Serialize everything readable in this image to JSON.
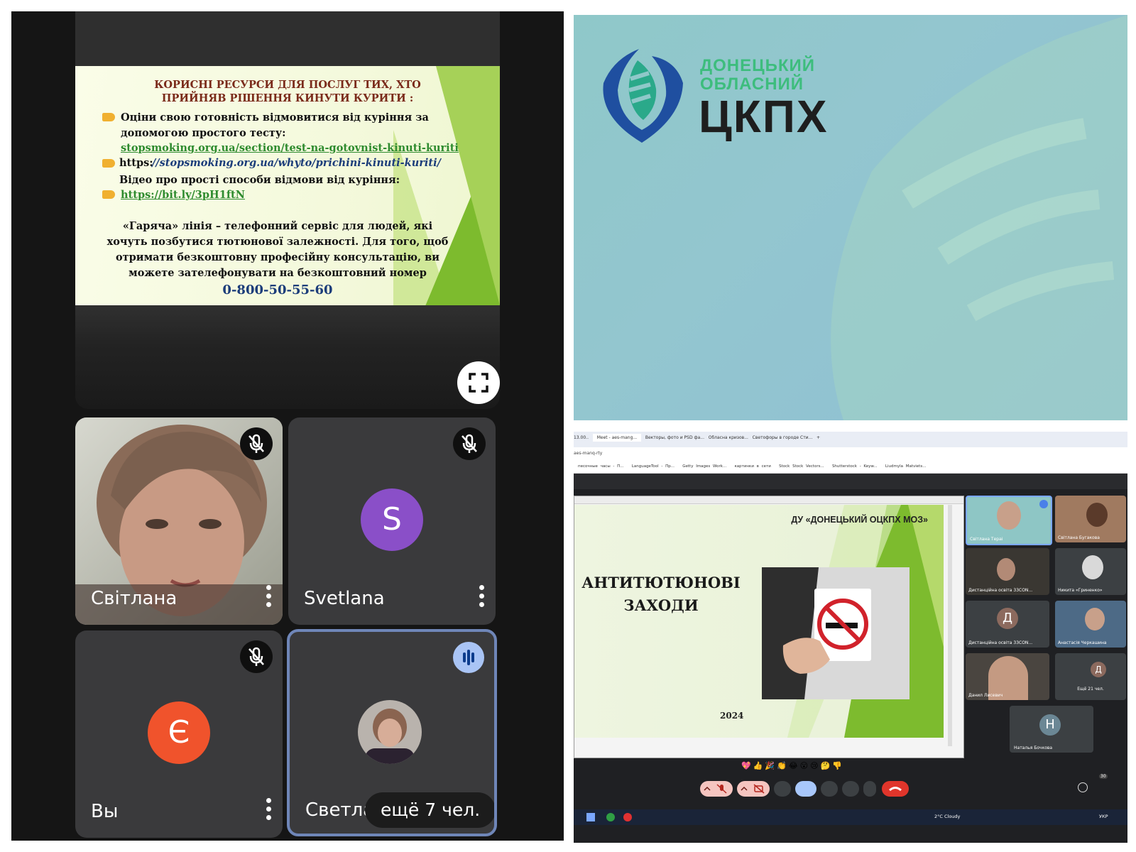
{
  "phone_meet": {
    "slide": {
      "title_line1": "КОРИСНІ РЕСУРСИ ДЛЯ ПОСЛУГ ТИХ, ХТО",
      "title_line2": "ПРИЙНЯВ РІШЕННЯ КИНУТИ КУРИТИ :",
      "bullet1_line1": "Оціни свою готовність відмовитися від куріння за",
      "bullet1_line2": "допомогою простого тесту:",
      "bullet1_link": "stopsmoking.org.ua/section/test-na-gotovnist-kinuti-kuriti",
      "bullet2_prefix": "https:",
      "bullet2_link": "//stopsmoking.org.ua/whyto/prichini-kinuti-kuriti/",
      "bullet3_line1": "Відео про прості способи відмови від куріння:",
      "bullet3_link": "https://bit.ly/3pH1ftN",
      "para_line1": "«Гаряча» лінія – телефонний сервіс для людей, які",
      "para_line2": "хочуть позбутися тютюнової залежності. Для того, щоб",
      "para_line3": "отримати безкоштовну професійну консультацію, ви",
      "para_line4": "можете зателефонувати на безкоштовний номер",
      "phone": "0-800-50-55-60"
    },
    "tiles": [
      {
        "name": "Світлана",
        "type": "video"
      },
      {
        "name": "Svetlana",
        "initial": "S",
        "color": "#8a4fc8"
      },
      {
        "name": "Вы",
        "initial": "Є",
        "color": "#f0532c"
      },
      {
        "name": "Светла"
      }
    ],
    "more_participants": "ещё 7 чел."
  },
  "logo": {
    "line1": "ДОНЕЦЬКИЙ",
    "line2": "ОБЛАСНИЙ",
    "line3": "ЦКПХ",
    "green": "#3dbd7d",
    "dark": "#1e1e1e",
    "blue": "#1f4fa0"
  },
  "desktop_meet": {
    "tabs": [
      "13.00..",
      "Meet - aes-mang...",
      "Векторы, фото и PSD фа...",
      "Обласна кризов...",
      "Светофоры в городе Сти...",
      "+"
    ],
    "address": "aes-manq-rty",
    "bookmarks": [
      "песочные часы - П...",
      "LanguageTool - Пр...",
      "Getty Images Work...",
      "картинки в сети",
      "Stock Stock Vectors...",
      "Shutterstock - Keyw...",
      "Liudmyla Matviets..."
    ],
    "slide": {
      "org": "ДУ «ДОНЕЦЬКИЙ ОЦКПХ МОЗ»",
      "title_line1": "АНТИТЮТЮНОВІ",
      "title_line2": "ЗАХОДИ",
      "year": "2024"
    },
    "gallery": [
      {
        "name": "Світлана Тераі"
      },
      {
        "name": "Світлана Бугакова"
      },
      {
        "name": "Дистанційна освіта 33CON..."
      },
      {
        "name": "Никита «Гриненко»"
      },
      {
        "name": "Дистанційна освіта 33CON...",
        "initial": "Д"
      },
      {
        "name": "Анастасія Черкашина"
      },
      {
        "name": "Данил Лисевич"
      },
      {
        "name": "Ещё 21 чел.",
        "initial": "Д"
      },
      {
        "name": "Наталья Бочкова",
        "initial": "Н"
      }
    ],
    "reactions": [
      "💖",
      "👍",
      "🎉",
      "👏",
      "😂",
      "😮",
      "😢",
      "🤔",
      "👎"
    ],
    "people_count": "30",
    "taskbar": {
      "weather": "2°C Cloudy",
      "lang": "УКР"
    }
  }
}
